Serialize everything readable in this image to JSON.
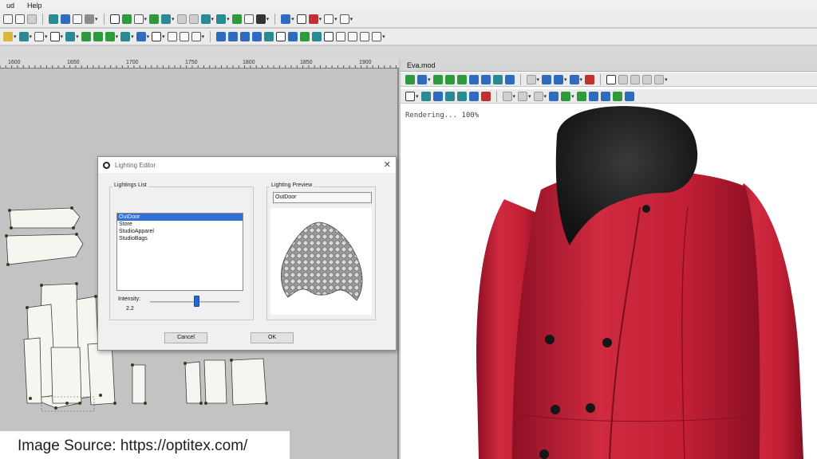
{
  "menubar": {
    "items": [
      {
        "label": "ud"
      },
      {
        "label": "Help"
      }
    ]
  },
  "ruler": {
    "labels": [
      "1600",
      "1650",
      "1700",
      "1750",
      "1800",
      "1850",
      "1900"
    ]
  },
  "model_window": {
    "title": "Eva.mod",
    "status": "Rendering... 100%"
  },
  "lighting_editor": {
    "title": "Lighting Editor",
    "list_group_label": "Lightings List",
    "items": [
      {
        "label": "OutDoor",
        "selected": true
      },
      {
        "label": "Store",
        "selected": false
      },
      {
        "label": "StudioApparel",
        "selected": false
      },
      {
        "label": "StudioBags",
        "selected": false
      }
    ],
    "intensity_label": "Intensity:",
    "intensity_value": "2.2",
    "intensity_slider_fraction": 0.52,
    "preview_group_label": "Lighting Preview",
    "preview_name": "OutDoor",
    "cancel_label": "Cancel",
    "ok_label": "OK"
  },
  "caption": {
    "text": "Image Source: https://optitex.com/"
  },
  "colors": {
    "coat": "#c21f36",
    "collar": "#1e1e1e",
    "selection": "#2f6fd6",
    "pattern_bg": "#c3c3c3"
  }
}
